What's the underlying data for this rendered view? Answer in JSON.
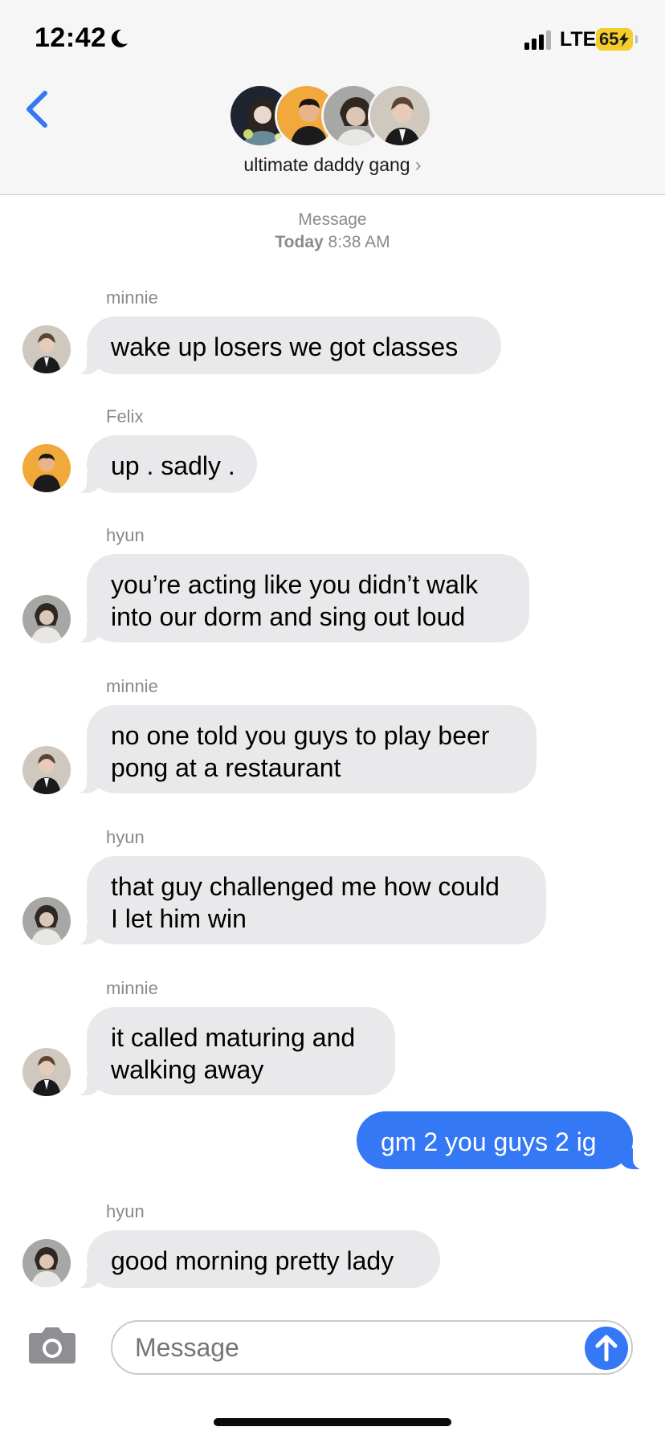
{
  "status_bar": {
    "time": "12:42",
    "network": "LTE",
    "battery": "65",
    "moon_icon": "moon-icon",
    "signal_icon": "cellular-signal-icon",
    "bolt_icon": "charging-bolt-icon"
  },
  "header": {
    "back_icon": "chevron-left-icon",
    "group_name": "ultimate daddy gang",
    "group_chevron": "›"
  },
  "thread": {
    "timestamp_label": "Message",
    "timestamp_day": "Today",
    "timestamp_time": "8:38 AM",
    "messages": [
      {
        "sender": "minnie",
        "text": "wake up losers we got classes"
      },
      {
        "sender": "Felix",
        "text": "up . sadly ."
      },
      {
        "sender": "hyun",
        "line1": "you’re acting like you didn’t walk",
        "line2": "into our dorm and sing out loud"
      },
      {
        "sender": "minnie",
        "line1": "no one told you guys to play beer",
        "line2": "pong at a restaurant"
      },
      {
        "sender": "hyun",
        "line1": "that guy challenged me how could",
        "line2": "I let him win"
      },
      {
        "sender": "minnie",
        "line1": "it called maturing and",
        "line2": "walking away"
      },
      {
        "sender": "me",
        "text": "gm 2 you guys 2 ig"
      },
      {
        "sender": "hyun",
        "text": "good morning pretty lady"
      }
    ]
  },
  "compose": {
    "placeholder": "Message",
    "camera_icon": "camera-icon",
    "send_icon": "send-arrow-icon"
  },
  "colors": {
    "accent_blue": "#3478f6",
    "incoming_bubble": "#e9e9eb",
    "battery_yellow": "#f4cd2a"
  }
}
